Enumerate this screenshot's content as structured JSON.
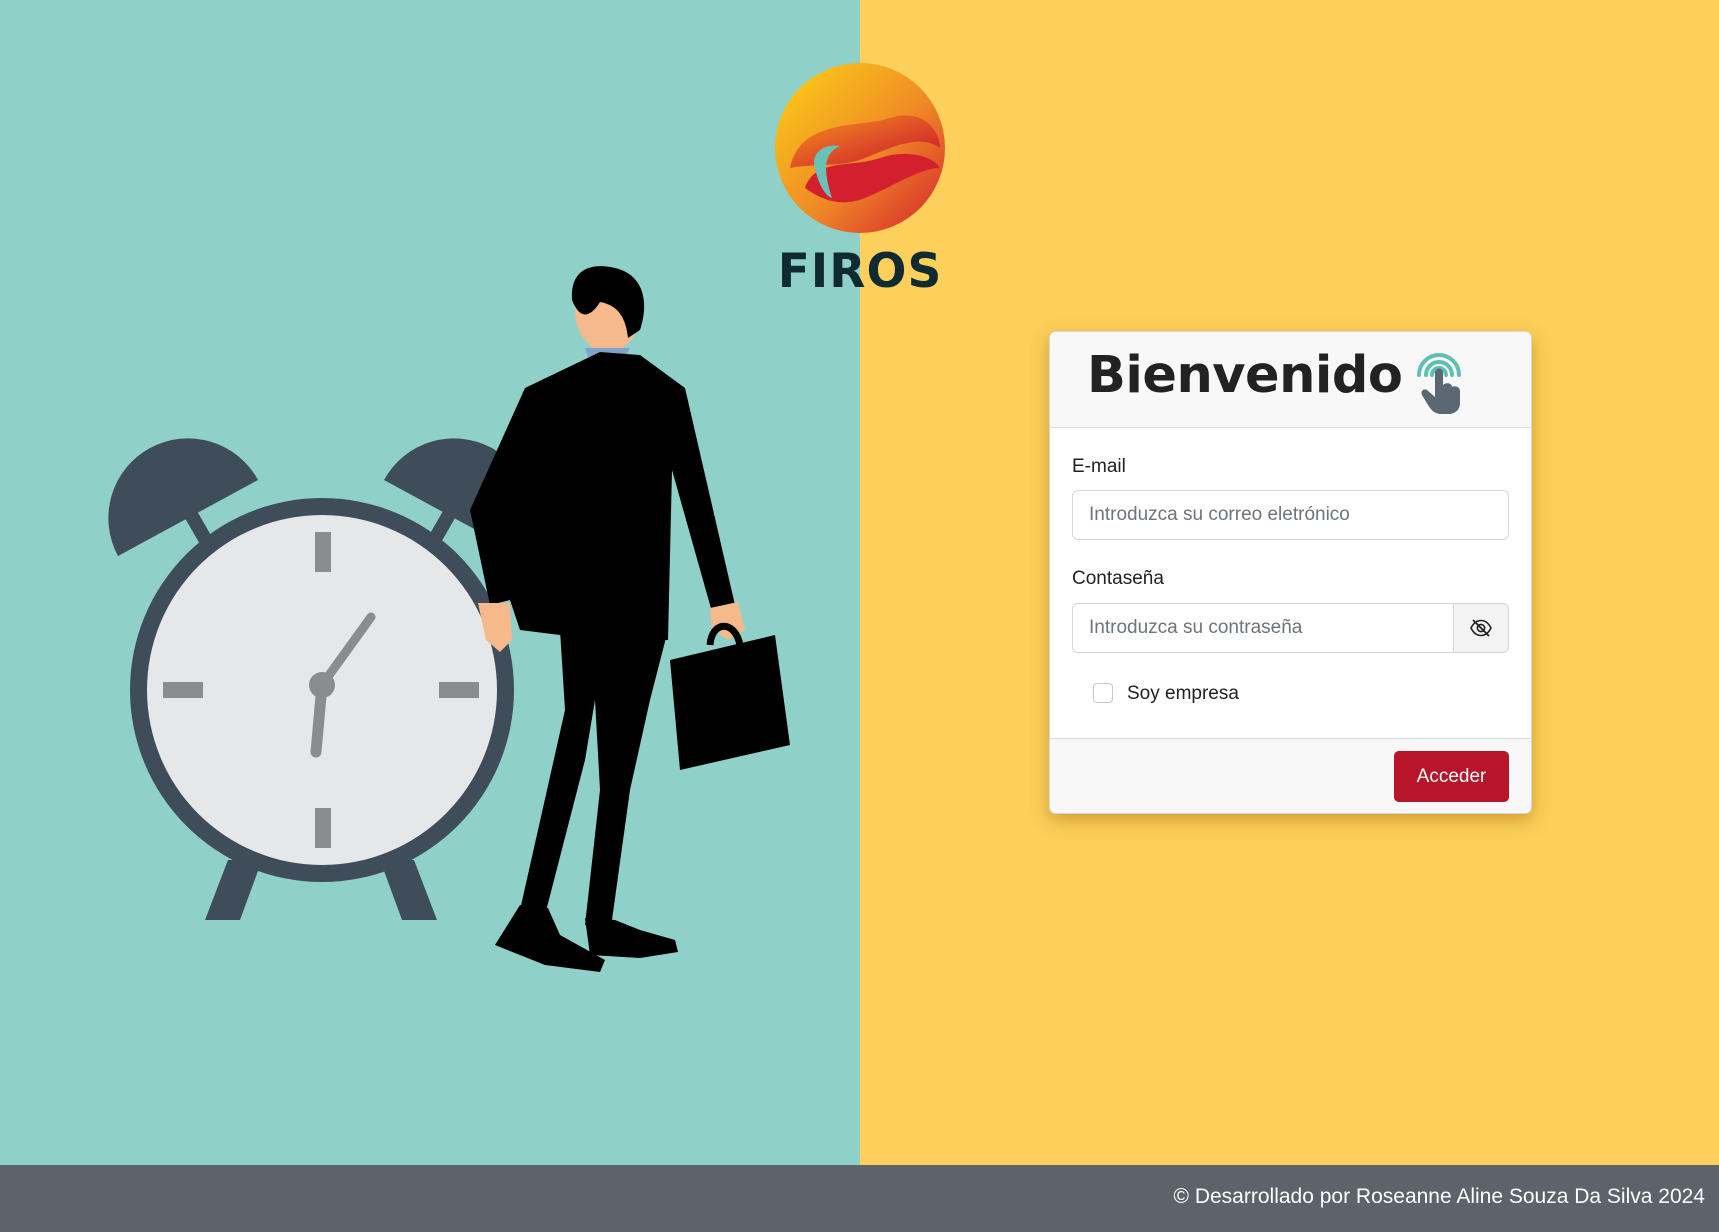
{
  "brand": {
    "name": "FIROS"
  },
  "card": {
    "title": "Bienvenido",
    "icon": "touch-fingerprint-icon"
  },
  "form": {
    "email": {
      "label": "E-mail",
      "placeholder": "Introduzca su correo eletrónico",
      "value": ""
    },
    "password": {
      "label": "Contaseña",
      "placeholder": "Introduzca su contraseña",
      "value": "",
      "toggle_icon": "eye-slash-icon"
    },
    "company_checkbox": {
      "label": "Soy empresa",
      "checked": false
    },
    "submit_label": "Acceder"
  },
  "illustration": {
    "description_icons": [
      "alarm-clock-icon",
      "businessman-icon",
      "briefcase-icon"
    ]
  },
  "footer": {
    "text": "© Desarrollado por Roseanne Aline Souza Da Silva 2024"
  },
  "colors": {
    "left_bg": "#8fd1c8",
    "right_bg": "#fcd05a",
    "accent": "#b8142a",
    "footer_bg": "#5c636a"
  }
}
